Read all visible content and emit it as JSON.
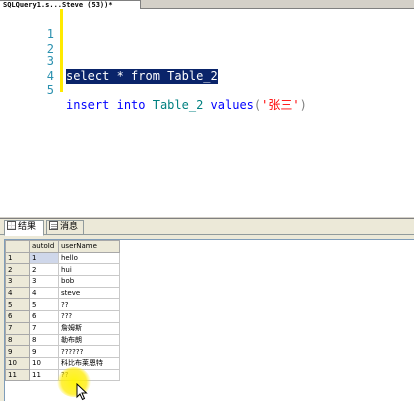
{
  "editor_tab": {
    "title": "SQLQuery1.s...Steve (53))*"
  },
  "editor": {
    "lines": [
      {
        "num": "1"
      },
      {
        "num": "2"
      },
      {
        "num": "3",
        "kw1": "select",
        "op": " * ",
        "kw2": "from",
        "obj": " Table_2"
      },
      {
        "num": "4"
      },
      {
        "num": "5",
        "kw1": "insert",
        "kw2": "into",
        "obj": "Table_2",
        "kw3": "values",
        "paren_open": "(",
        "str": "'张三'",
        "paren_close": ")"
      }
    ]
  },
  "results_tabs": [
    {
      "label": "结果",
      "icon": "grid-icon",
      "active": true
    },
    {
      "label": "消息",
      "icon": "message-icon",
      "active": false
    }
  ],
  "grid": {
    "columns": [
      "autoId",
      "userName"
    ],
    "rows": [
      {
        "rn": "1",
        "autoId": "1",
        "userName": "hello"
      },
      {
        "rn": "2",
        "autoId": "2",
        "userName": "hui"
      },
      {
        "rn": "3",
        "autoId": "3",
        "userName": "bob"
      },
      {
        "rn": "4",
        "autoId": "4",
        "userName": "steve"
      },
      {
        "rn": "5",
        "autoId": "5",
        "userName": "??"
      },
      {
        "rn": "6",
        "autoId": "6",
        "userName": "???"
      },
      {
        "rn": "7",
        "autoId": "7",
        "userName": "詹姆斯"
      },
      {
        "rn": "8",
        "autoId": "8",
        "userName": "勒布朗"
      },
      {
        "rn": "9",
        "autoId": "9",
        "userName": "??????"
      },
      {
        "rn": "10",
        "autoId": "10",
        "userName": "科比布莱恩特"
      },
      {
        "rn": "11",
        "autoId": "11",
        "userName": "??"
      }
    ]
  },
  "colors": {
    "keyword": "#0000ff",
    "object": "#008080",
    "string": "#ff0000",
    "selection": "#0a246a",
    "line_number": "#2b91af",
    "change_bar": "#ffea00"
  }
}
